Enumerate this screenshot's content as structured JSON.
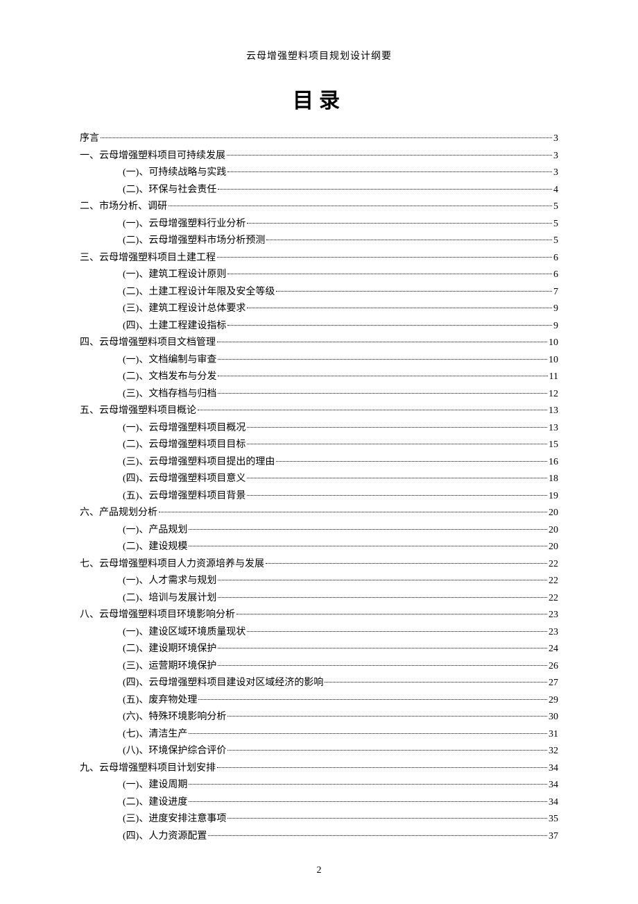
{
  "header": "云母增强塑料项目规划设计纲要",
  "title": "目录",
  "page_number": "2",
  "toc": [
    {
      "level": 1,
      "label": "序言",
      "page": "3"
    },
    {
      "level": 1,
      "label": "一、云母增强塑料项目可持续发展",
      "page": "3"
    },
    {
      "level": 2,
      "label": "(一)、可持续战略与实践",
      "page": "3"
    },
    {
      "level": 2,
      "label": "(二)、环保与社会责任",
      "page": "4"
    },
    {
      "level": 1,
      "label": "二、市场分析、调研",
      "page": "5"
    },
    {
      "level": 2,
      "label": "(一)、云母增强塑料行业分析",
      "page": "5"
    },
    {
      "level": 2,
      "label": "(二)、云母增强塑料市场分析预测",
      "page": "5"
    },
    {
      "level": 1,
      "label": "三、云母增强塑料项目土建工程",
      "page": "6"
    },
    {
      "level": 2,
      "label": "(一)、建筑工程设计原则",
      "page": "6"
    },
    {
      "level": 2,
      "label": "(二)、土建工程设计年限及安全等级",
      "page": "7"
    },
    {
      "level": 2,
      "label": "(三)、建筑工程设计总体要求",
      "page": "9"
    },
    {
      "level": 2,
      "label": "(四)、土建工程建设指标",
      "page": "9"
    },
    {
      "level": 1,
      "label": "四、云母增强塑料项目文档管理",
      "page": "10"
    },
    {
      "level": 2,
      "label": "(一)、文档编制与审查",
      "page": "10"
    },
    {
      "level": 2,
      "label": "(二)、文档发布与分发",
      "page": "11"
    },
    {
      "level": 2,
      "label": "(三)、文档存档与归档",
      "page": "12"
    },
    {
      "level": 1,
      "label": "五、云母增强塑料项目概论",
      "page": "13"
    },
    {
      "level": 2,
      "label": "(一)、云母增强塑料项目概况",
      "page": "13"
    },
    {
      "level": 2,
      "label": "(二)、云母增强塑料项目目标",
      "page": "15"
    },
    {
      "level": 2,
      "label": "(三)、云母增强塑料项目提出的理由",
      "page": "16"
    },
    {
      "level": 2,
      "label": "(四)、云母增强塑料项目意义",
      "page": "18"
    },
    {
      "level": 2,
      "label": "(五)、云母增强塑料项目背景",
      "page": "19"
    },
    {
      "level": 1,
      "label": "六、产品规划分析",
      "page": "20"
    },
    {
      "level": 2,
      "label": "(一)、产品规划",
      "page": "20"
    },
    {
      "level": 2,
      "label": "(二)、建设规模",
      "page": "20"
    },
    {
      "level": 1,
      "label": "七、云母增强塑料项目人力资源培养与发展",
      "page": "22"
    },
    {
      "level": 2,
      "label": "(一)、人才需求与规划",
      "page": "22"
    },
    {
      "level": 2,
      "label": "(二)、培训与发展计划",
      "page": "22"
    },
    {
      "level": 1,
      "label": "八、云母增强塑料项目环境影响分析",
      "page": "23"
    },
    {
      "level": 2,
      "label": "(一)、建设区域环境质量现状",
      "page": "23"
    },
    {
      "level": 2,
      "label": "(二)、建设期环境保护",
      "page": "24"
    },
    {
      "level": 2,
      "label": "(三)、运营期环境保护",
      "page": "26"
    },
    {
      "level": 2,
      "label": "(四)、云母增强塑料项目建设对区域经济的影响",
      "page": "27"
    },
    {
      "level": 2,
      "label": "(五)、废弃物处理",
      "page": "29"
    },
    {
      "level": 2,
      "label": "(六)、特殊环境影响分析",
      "page": "30"
    },
    {
      "level": 2,
      "label": "(七)、清洁生产",
      "page": "31"
    },
    {
      "level": 2,
      "label": "(八)、环境保护综合评价",
      "page": "32"
    },
    {
      "level": 1,
      "label": "九、云母增强塑料项目计划安排",
      "page": "34"
    },
    {
      "level": 2,
      "label": "(一)、建设周期",
      "page": "34"
    },
    {
      "level": 2,
      "label": "(二)、建设进度",
      "page": "34"
    },
    {
      "level": 2,
      "label": "(三)、进度安排注意事项",
      "page": "35"
    },
    {
      "level": 2,
      "label": "(四)、人力资源配置",
      "page": "37"
    }
  ]
}
